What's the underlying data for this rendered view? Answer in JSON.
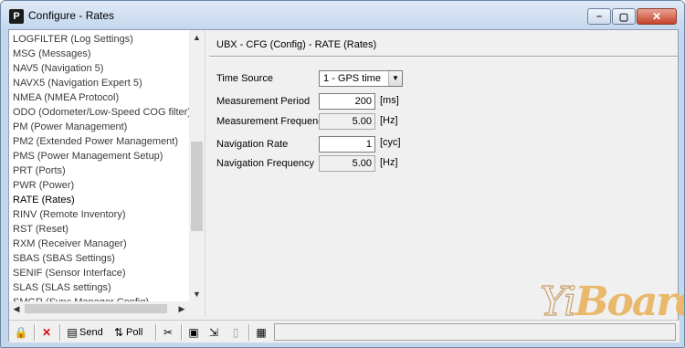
{
  "window": {
    "title": "Configure - Rates",
    "app_icon": "P",
    "buttons": {
      "minimize": "minimize-icon",
      "maximize": "maximize-icon",
      "close": "close-icon"
    }
  },
  "message_list": {
    "items": [
      "LOGFILTER (Log Settings)",
      "MSG (Messages)",
      "NAV5 (Navigation 5)",
      "NAVX5 (Navigation Expert 5)",
      "NMEA (NMEA Protocol)",
      "ODO (Odometer/Low-Speed COG filter)",
      "PM (Power Management)",
      "PM2 (Extended Power Management)",
      "PMS (Power Management Setup)",
      "PRT (Ports)",
      "PWR (Power)",
      "RATE (Rates)",
      "RINV (Remote Inventory)",
      "RST (Reset)",
      "RXM (Receiver Manager)",
      "SBAS (SBAS Settings)",
      "SENIF (Sensor Interface)",
      "SLAS (SLAS settings)",
      "SMGR (Sync Manager Config)"
    ],
    "selected": "RATE (Rates)"
  },
  "detail": {
    "header": "UBX - CFG (Config) - RATE (Rates)",
    "time_source": {
      "label": "Time Source",
      "value": "1 - GPS time"
    },
    "measurement_period": {
      "label": "Measurement Period",
      "value": "200",
      "unit": "[ms]"
    },
    "measurement_frequency": {
      "label": "Measurement Frequency",
      "value": "5.00",
      "unit": "[Hz]"
    },
    "navigation_rate": {
      "label": "Navigation Rate",
      "value": "1",
      "unit": "[cyc]"
    },
    "navigation_frequency": {
      "label": "Navigation Frequency",
      "value": "5.00",
      "unit": "[Hz]"
    }
  },
  "toolbar": {
    "send_label": "Send",
    "poll_label": "Poll"
  },
  "watermark": {
    "text": "YiBoard"
  },
  "colors": {
    "titlebar": "#c5d8ee",
    "close_button": "#c7432a",
    "panel_bg": "#f0f0f0"
  }
}
